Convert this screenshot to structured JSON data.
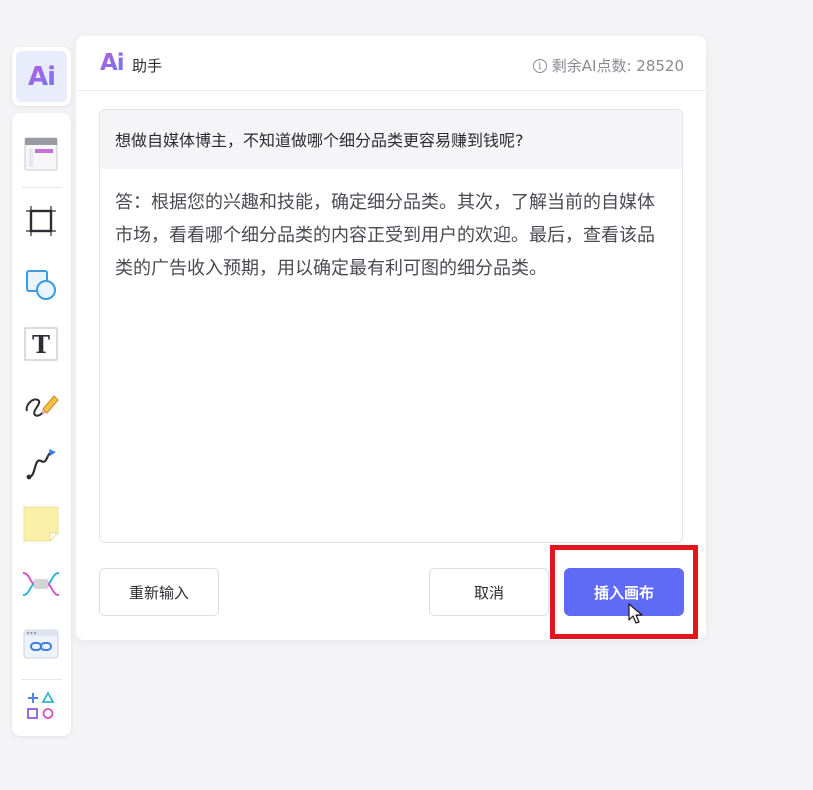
{
  "toolbar": {
    "ai_badge": "Ai",
    "tools": [
      {
        "name": "template-icon"
      },
      {
        "name": "frame-icon"
      },
      {
        "name": "shape-icon"
      },
      {
        "name": "text-icon"
      },
      {
        "name": "pen-icon"
      },
      {
        "name": "connector-icon"
      },
      {
        "name": "sticky-note-icon"
      },
      {
        "name": "mindmap-icon"
      },
      {
        "name": "link-embed-icon"
      },
      {
        "name": "more-shapes-icon"
      }
    ]
  },
  "panel": {
    "logo_text": "Ai",
    "title": "助手",
    "quota_text": "剩余AI点数: 28520",
    "question": "想做自媒体博主，不知道做哪个细分品类更容易赚到钱呢?",
    "answer": "答：根据您的兴趣和技能，确定细分品类。其次，了解当前的自媒体市场，看看哪个细分品类的内容正受到用户的欢迎。最后，查看该品类的广告收入预期，用以确定最有利可图的细分品类。",
    "buttons": {
      "reinput": "重新输入",
      "cancel": "取消",
      "insert": "插入画布"
    }
  },
  "colors": {
    "accent": "#5f6af7",
    "highlight": "#e4141e",
    "ai_gradient_start": "#b75ce0",
    "ai_gradient_end": "#6b7bf5"
  }
}
